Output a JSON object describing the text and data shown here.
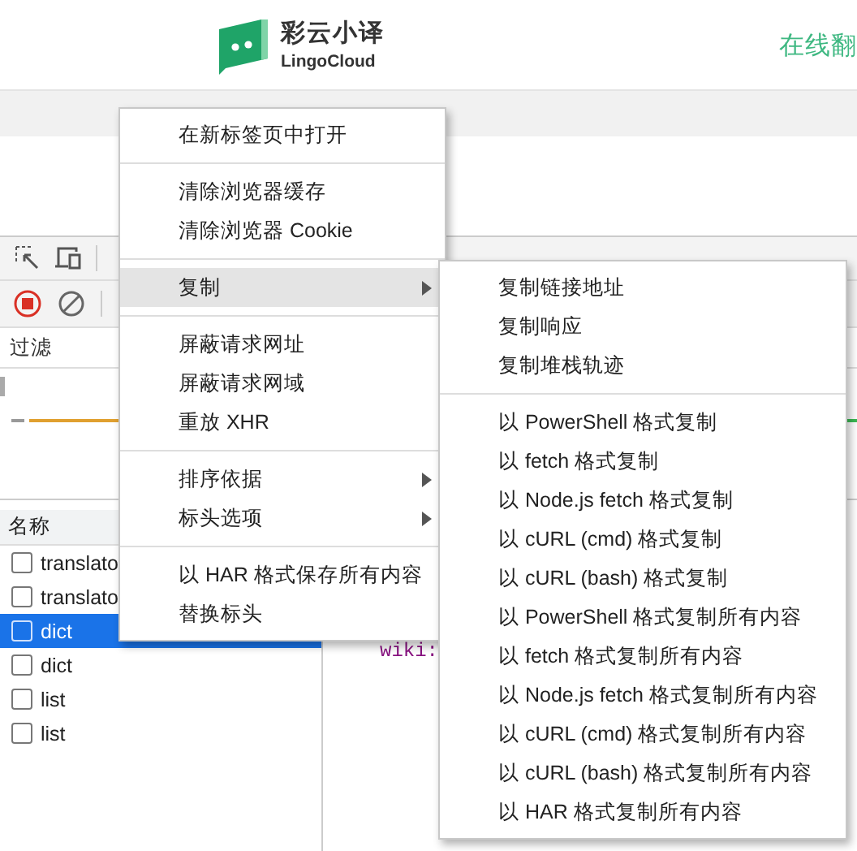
{
  "header": {
    "brand_name": "彩云小译",
    "brand_sub": "LingoCloud",
    "nav_link": "在线翻"
  },
  "devtools": {
    "recording": true,
    "filter": {
      "placeholder": "过滤"
    },
    "requests": {
      "column": "名称",
      "rows": [
        {
          "name": "translato",
          "selected": false
        },
        {
          "name": "translato",
          "selected": false
        },
        {
          "name": "dict",
          "selected": true
        },
        {
          "name": "dict",
          "selected": false
        },
        {
          "name": "list",
          "selected": false
        },
        {
          "name": "list",
          "selected": false
        }
      ]
    },
    "preview_text": "wiki:"
  },
  "context_menu": {
    "groups": [
      {
        "items": [
          {
            "label": "在新标签页中打开",
            "selected": false,
            "has_submenu": false
          }
        ]
      },
      {
        "items": [
          {
            "label": "清除浏览器缓存",
            "selected": false,
            "has_submenu": false
          },
          {
            "label": "清除浏览器 Cookie",
            "selected": false,
            "has_submenu": false
          }
        ]
      },
      {
        "items": [
          {
            "label": "复制",
            "selected": true,
            "has_submenu": true
          }
        ]
      },
      {
        "items": [
          {
            "label": "屏蔽请求网址",
            "selected": false,
            "has_submenu": false
          },
          {
            "label": "屏蔽请求网域",
            "selected": false,
            "has_submenu": false
          },
          {
            "label": "重放 XHR",
            "selected": false,
            "has_submenu": false
          }
        ]
      },
      {
        "items": [
          {
            "label": "排序依据",
            "selected": false,
            "has_submenu": true
          },
          {
            "label": "标头选项",
            "selected": false,
            "has_submenu": true
          }
        ]
      },
      {
        "items": [
          {
            "label": "以 HAR 格式保存所有内容",
            "selected": false,
            "has_submenu": false
          },
          {
            "label": "替换标头",
            "selected": false,
            "has_submenu": false
          }
        ]
      }
    ]
  },
  "submenu": {
    "groups": [
      {
        "items": [
          {
            "label": "复制链接地址",
            "selected": false,
            "has_submenu": false
          },
          {
            "label": "复制响应",
            "selected": false,
            "has_submenu": false
          },
          {
            "label": "复制堆栈轨迹",
            "selected": false,
            "has_submenu": false
          }
        ]
      },
      {
        "items": [
          {
            "label": "以 PowerShell 格式复制",
            "selected": false,
            "has_submenu": false
          },
          {
            "label": "以 fetch 格式复制",
            "selected": false,
            "has_submenu": false
          },
          {
            "label": "以 Node.js fetch 格式复制",
            "selected": false,
            "has_submenu": false
          },
          {
            "label": "以 cURL (cmd) 格式复制",
            "selected": false,
            "has_submenu": false
          },
          {
            "label": "以 cURL (bash) 格式复制",
            "selected": false,
            "has_submenu": false
          },
          {
            "label": "以 PowerShell 格式复制所有内容",
            "selected": false,
            "has_submenu": false
          },
          {
            "label": "以 fetch 格式复制所有内容",
            "selected": false,
            "has_submenu": false
          },
          {
            "label": "以 Node.js fetch 格式复制所有内容",
            "selected": false,
            "has_submenu": false
          },
          {
            "label": "以 cURL (cmd) 格式复制所有内容",
            "selected": false,
            "has_submenu": false
          },
          {
            "label": "以 cURL (bash) 格式复制所有内容",
            "selected": false,
            "has_submenu": false
          },
          {
            "label": "以 HAR 格式复制所有内容",
            "selected": false,
            "has_submenu": false
          }
        ]
      }
    ]
  }
}
